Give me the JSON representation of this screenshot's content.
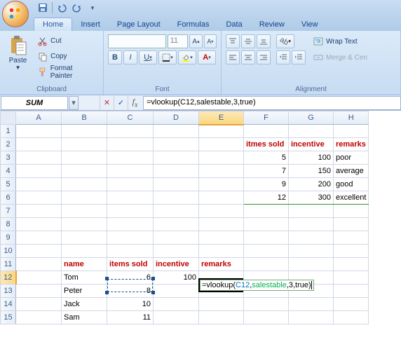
{
  "qat": {
    "save": "save",
    "undo": "undo",
    "redo": "redo"
  },
  "tabs": [
    "Home",
    "Insert",
    "Page Layout",
    "Formulas",
    "Data",
    "Review",
    "View"
  ],
  "active_tab": 0,
  "ribbon": {
    "clipboard": {
      "label": "Clipboard",
      "paste": "Paste",
      "cut": "Cut",
      "copy": "Copy",
      "format_painter": "Format Painter"
    },
    "font": {
      "label": "Font",
      "name": "",
      "size": "11",
      "bold": "B",
      "italic": "I",
      "underline": "U"
    },
    "alignment": {
      "label": "Alignment",
      "wrap": "Wrap Text",
      "merge": "Merge & Cen"
    }
  },
  "name_box": "SUM",
  "formula": "=vlookup(C12,salestable,3,true)",
  "formula_tokens": {
    "pre": "=vlookup(",
    "ref": "C12",
    "c1": ",",
    "name": "salestable",
    "post": ",3,true)"
  },
  "columns": [
    "A",
    "B",
    "C",
    "D",
    "E",
    "F",
    "G",
    "H"
  ],
  "rows": [
    "1",
    "2",
    "3",
    "4",
    "5",
    "6",
    "7",
    "8",
    "9",
    "10",
    "11",
    "12",
    "13",
    "14",
    "15"
  ],
  "active_col": "E",
  "active_row": "12",
  "chart_data": {
    "type": "table",
    "lookup_table": {
      "headers": [
        "itmes sold",
        "incentive",
        "remarks"
      ],
      "rows": [
        [
          5,
          100,
          "poor"
        ],
        [
          7,
          150,
          "average"
        ],
        [
          9,
          200,
          "good"
        ],
        [
          12,
          300,
          "excellent"
        ]
      ]
    },
    "sales_table": {
      "headers": [
        "name",
        "items sold",
        "incentive",
        "remarks"
      ],
      "rows": [
        [
          "Tom",
          6,
          100,
          "=vlookup(C12,salestable,3,true)"
        ],
        [
          "Peter",
          8,
          null,
          null
        ],
        [
          "Jack",
          10,
          null,
          null
        ],
        [
          "Sam",
          11,
          null,
          null
        ]
      ]
    }
  },
  "cells": {
    "F2": "itmes sold",
    "G2": "incentive",
    "H2": "remarks",
    "F3": "5",
    "G3": "100",
    "H3": "poor",
    "F4": "7",
    "G4": "150",
    "H4": "average",
    "F5": "9",
    "G5": "200",
    "H5": "good",
    "F6": "12",
    "G6": "300",
    "H6": "excellent",
    "B11": "name",
    "C11": "items sold",
    "D11": "incentive",
    "E11": "remarks",
    "B12": "Tom",
    "C12": "6",
    "D12": "100",
    "B13": "Peter",
    "C13": "8",
    "B14": "Jack",
    "C14": "10",
    "B15": "Sam",
    "C15": "11"
  }
}
